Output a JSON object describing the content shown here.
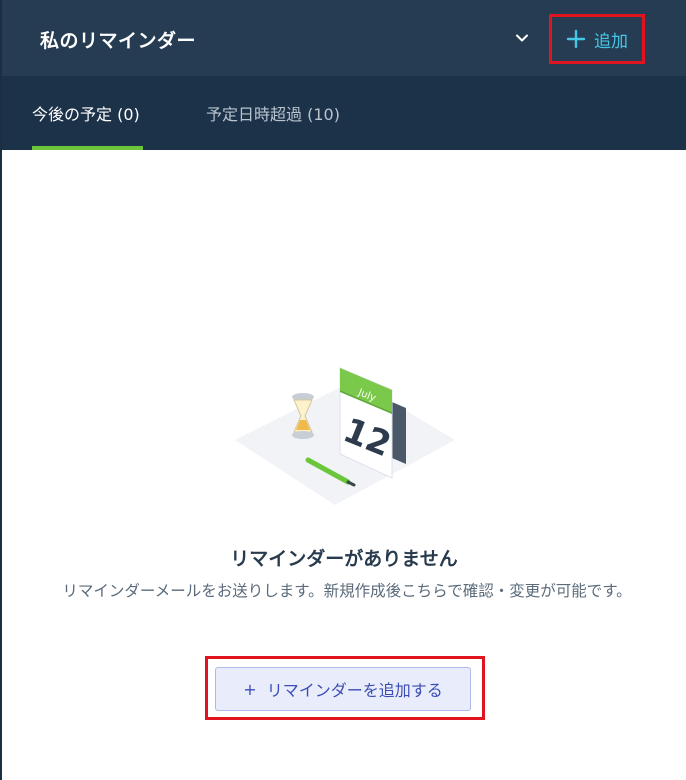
{
  "header": {
    "title": "私のリマインダー",
    "add_label": "追加",
    "chevron_icon": "chevron-down-icon",
    "plus_icon": "plus-icon"
  },
  "tabs": [
    {
      "label": "今後の予定 (0)",
      "active": true
    },
    {
      "label": "予定日時超過 (10)",
      "active": false
    }
  ],
  "illustration": {
    "calendar_month": "July",
    "calendar_day": "12",
    "icons": [
      "calendar-icon",
      "hourglass-icon",
      "pencil-icon"
    ]
  },
  "empty_state": {
    "title": "リマインダーがありません",
    "description": "リマインダーメールをお送りします。新規作成後こちらで確認・変更が可能です。",
    "button_label": "リマインダーを追加する",
    "button_plus": "+"
  },
  "colors": {
    "header_bg": "#263c52",
    "tabs_bg": "#1c3249",
    "accent_cyan": "#45c6e6",
    "active_tab_underline": "#6cc63c",
    "highlight_red": "#e0141e",
    "button_text": "#3b4db5"
  }
}
